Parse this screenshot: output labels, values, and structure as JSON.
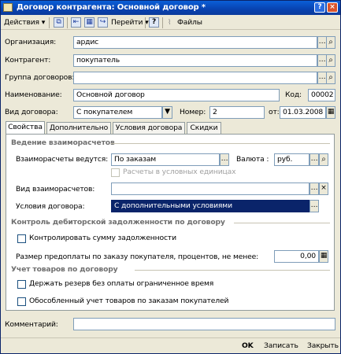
{
  "window": {
    "title": "Договор контрагента: Основной договор *",
    "help_glyph": "?",
    "close_glyph": "×"
  },
  "toolbar": {
    "actions_label": "Действия",
    "goto_label": "Перейти",
    "help_label": "?",
    "files_label": "Файлы"
  },
  "header": {
    "organization_label": "Организация:",
    "organization_value": "ардис",
    "counterparty_label": "Контрагент:",
    "counterparty_value": "покупатель",
    "contract_group_label": "Группа договоров:",
    "contract_group_value": "",
    "name_label": "Наименование:",
    "name_value": "Основной договор",
    "code_label": "Код:",
    "code_value": "00002",
    "contract_kind_label": "Вид договора:",
    "contract_kind_value": "С покупателем",
    "number_label": "Номер:",
    "number_value": "2",
    "date_label": "от:",
    "date_value": "01.03.2008"
  },
  "tabs": [
    {
      "label": "Свойства",
      "active": true
    },
    {
      "label": "Дополнительно",
      "active": false
    },
    {
      "label": "Условия договора",
      "active": false
    },
    {
      "label": "Скидки",
      "active": false
    }
  ],
  "settlements": {
    "section_title": "Ведение взаиморасчетов",
    "conducted_label": "Взаиморасчеты ведутся:",
    "conducted_value": "По заказам",
    "currency_label": "Валюта :",
    "currency_value": "руб.",
    "conventional_units_label": "Расчеты в условных единицах",
    "kind_label": "Вид взаиморасчетов:",
    "kind_value": "",
    "terms_label": "Условия договора:",
    "terms_value": "С дополнительными условиями"
  },
  "receivables": {
    "section_title": "Контроль дебиторской задолженности по договору",
    "control_amount_label": "Контролировать сумму задолженности",
    "prepayment_label": "Размер предоплаты по заказу покупателя, процентов, не менее:",
    "prepayment_value": "0,00"
  },
  "goods": {
    "section_title": "Учет товаров по договору",
    "reserve_label": "Держать резерв без оплаты ограниченное время",
    "separate_label": "Обособленный учет товаров по заказам покупателей"
  },
  "comment": {
    "label": "Комментарий:",
    "value": ""
  },
  "buttons": {
    "ok": "OK",
    "save": "Записать",
    "close": "Закрыть"
  }
}
